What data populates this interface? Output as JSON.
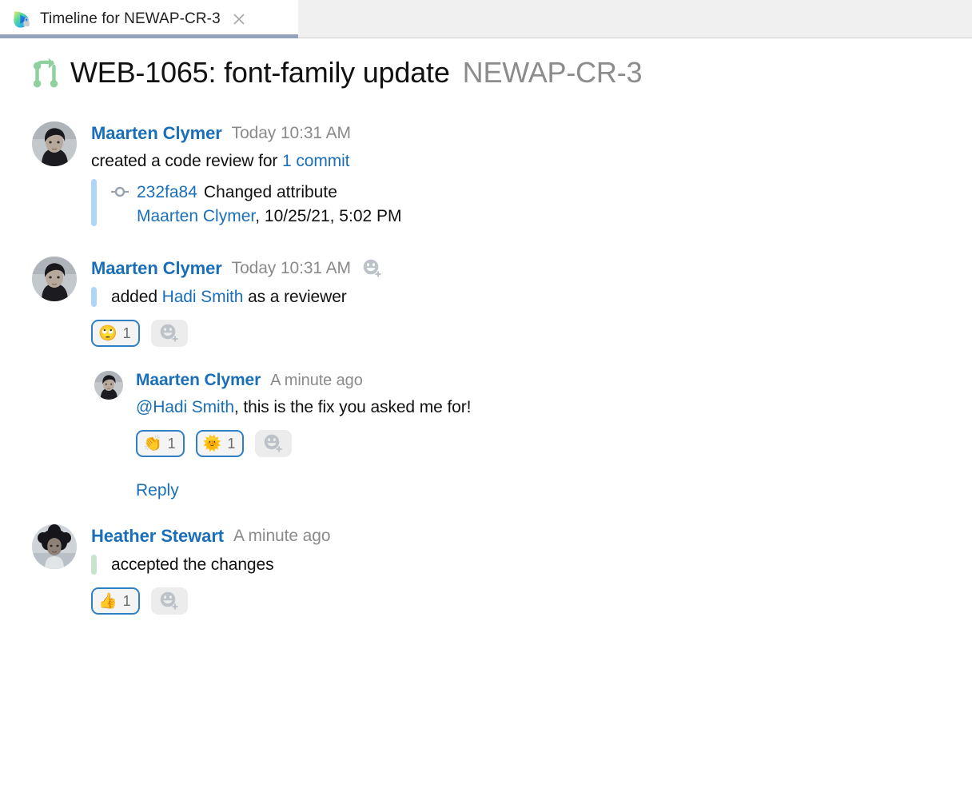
{
  "tab": {
    "title": "Timeline for NEWAP-CR-3",
    "icon": "app-logo-icon",
    "close_icon": "close-icon"
  },
  "header": {
    "branch_icon": "merge-branch-icon",
    "title": "WEB-1065: font-family update",
    "key": "NEWAP-CR-3"
  },
  "colors": {
    "link": "#1a6fb8",
    "muted": "#8a8a8a",
    "quote_blue": "#aed6f8",
    "quote_green": "#c7e3ce",
    "chip_border": "#2f7fc4",
    "tab_underline": "#94a3bb"
  },
  "events": [
    {
      "author": "Maarten Clymer",
      "timestamp": "Today 10:31 AM",
      "action_prefix": "created a code review for ",
      "action_link": "1 commit",
      "commit": {
        "hash": "232fa84",
        "message": "Changed attribute",
        "sub_author": "Maarten Clymer",
        "sub_rest": ", 10/25/21, 5:02 PM"
      }
    },
    {
      "author": "Maarten Clymer",
      "timestamp": "Today 10:31 AM",
      "quote_prefix": "added ",
      "quote_link": "Hadi Smith",
      "quote_suffix": " as a reviewer",
      "reactions": [
        {
          "emoji": "🙄",
          "name": "face-with-rolling-eyes",
          "count": "1"
        }
      ],
      "add_reaction_label": "add-reaction"
    },
    {
      "author": "Maarten Clymer",
      "timestamp": "A minute ago",
      "mention": "@Hadi Smith",
      "comment_rest": ", this is the fix you asked me for!",
      "reactions": [
        {
          "emoji": "👏",
          "name": "clapping-hands",
          "count": "1"
        },
        {
          "emoji": "🌞",
          "name": "sun-with-face",
          "count": "1"
        }
      ],
      "reply_label": "Reply"
    },
    {
      "author": "Heather Stewart",
      "timestamp": "A minute ago",
      "quote_text": "accepted the changes",
      "reactions": [
        {
          "emoji": "👍",
          "name": "thumbs-up",
          "count": "1"
        }
      ]
    }
  ]
}
